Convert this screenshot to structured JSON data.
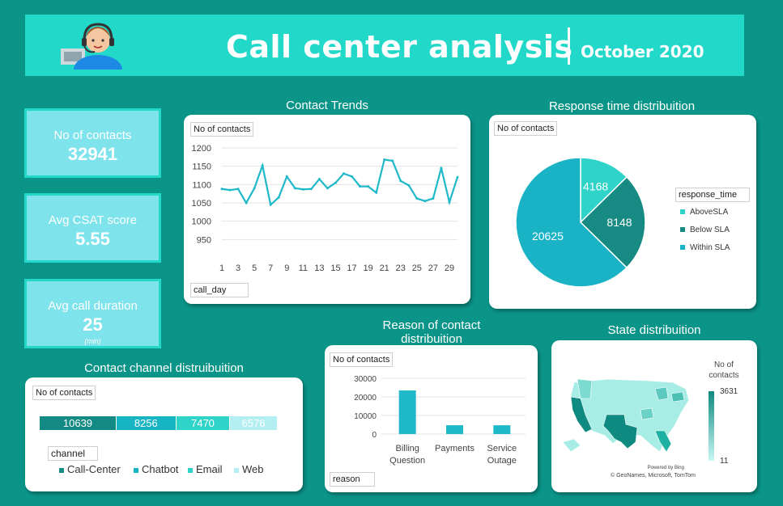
{
  "header": {
    "title": "Call center analysis",
    "subtitle": "October 2020",
    "avatar_icon": "call-center-agent-icon"
  },
  "kpis": [
    {
      "label": "No of contacts",
      "value": "32941"
    },
    {
      "label": "Avg CSAT score",
      "value": "5.55"
    },
    {
      "label": "Avg call duration",
      "value": "25",
      "unit": "(min)"
    }
  ],
  "contact_trends": {
    "title": "Contact Trends",
    "value_field": "No of contacts",
    "axis_field": "call_day"
  },
  "response_time": {
    "title": "Response time distribuition",
    "value_field": "No of contacts",
    "legend_field": "response_time"
  },
  "reason": {
    "title": "Reason of contact distribuition",
    "value_field": "No of contacts",
    "axis_field": "reason"
  },
  "state": {
    "title": "State distribuition",
    "legend_title": "No of contacts",
    "legend_max": "3631",
    "legend_min": "11",
    "powered_by": "Powered by Bing",
    "credits": "© GeoNames, Microsoft, TomTom"
  },
  "channel": {
    "title": "Contact channel distruibuition",
    "value_field": "No of contacts",
    "legend_field": "channel"
  },
  "colors": {
    "background": "#0b9488",
    "header": "#22d8c9",
    "kpi": "#7fe3ec",
    "line": "#1fb9c9",
    "above_sla": "#2fd3c7",
    "below_sla": "#178a83",
    "within_sla": "#1ab3c6"
  },
  "chart_data": [
    {
      "type": "line",
      "title": "Contact Trends",
      "xlabel": "call_day",
      "ylabel": "No of contacts",
      "ylim": [
        900,
        1200
      ],
      "yticks": [
        950,
        1000,
        1050,
        1100,
        1150,
        1200
      ],
      "xticks": [
        "1",
        "3",
        "5",
        "7",
        "9",
        "11",
        "13",
        "15",
        "17",
        "19",
        "21",
        "23",
        "25",
        "27",
        "29"
      ],
      "x": [
        1,
        2,
        3,
        4,
        5,
        6,
        7,
        8,
        9,
        10,
        11,
        12,
        13,
        14,
        15,
        16,
        17,
        18,
        19,
        20,
        21,
        22,
        23,
        24,
        25,
        26,
        27,
        28,
        29,
        30
      ],
      "values": [
        1088,
        1085,
        1088,
        1050,
        1090,
        1152,
        1045,
        1065,
        1122,
        1090,
        1087,
        1088,
        1115,
        1090,
        1105,
        1130,
        1122,
        1095,
        1095,
        1078,
        1168,
        1165,
        1110,
        1098,
        1062,
        1055,
        1062,
        1145,
        1052,
        1120
      ],
      "grid": true
    },
    {
      "type": "pie",
      "title": "Response time distribuition",
      "legend_title": "response_time",
      "categories": [
        "AboveSLA",
        "Below SLA",
        "Within SLA"
      ],
      "values": [
        4168,
        8148,
        20625
      ],
      "colors": [
        "#2fd3c7",
        "#178a83",
        "#1ab3c6"
      ],
      "legend": "right"
    },
    {
      "type": "bar",
      "title": "Reason of contact distribuition",
      "xlabel": "reason",
      "ylabel": "No of contacts",
      "categories": [
        "Billing Question",
        "Payments",
        "Service Outage"
      ],
      "values": [
        23462,
        4749,
        4730
      ],
      "ylim": [
        0,
        30000
      ],
      "yticks": [
        0,
        10000,
        20000,
        30000
      ],
      "grid": true
    },
    {
      "type": "bar",
      "title": "Contact channel distruibuition",
      "legend_title": "channel",
      "categories": [
        "Call-Center",
        "Chatbot",
        "Email",
        "Web"
      ],
      "values": [
        10639,
        8256,
        7470,
        6576
      ],
      "colors": [
        "#138a83",
        "#17b4c3",
        "#2fd3c7",
        "#b2eef2"
      ],
      "stacked": true,
      "legend": "bottom"
    }
  ]
}
